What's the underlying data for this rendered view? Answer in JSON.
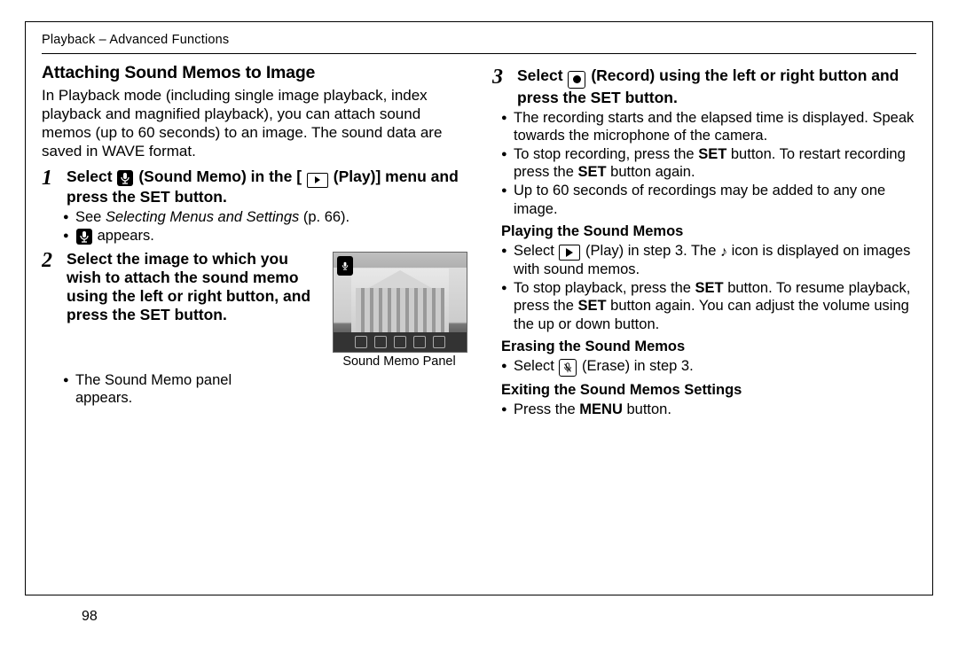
{
  "header": "Playback – Advanced Functions",
  "title": "Attaching Sound Memos to Image",
  "intro": "In Playback mode (including single image playback, index playback and magnified playback), you can attach sound memos (up to 60 seconds) to an image. The sound data are saved in WAVE format.",
  "step1_num": "1",
  "step1_a": "Select ",
  "step1_b": " (Sound Memo) in the [",
  "step1_c": " (Play)] menu and press the SET button.",
  "step1_bullets": {
    "b1a": "See ",
    "b1b": "Selecting Menus and Settings",
    "b1c": " (p. 66).",
    "b2": " appears."
  },
  "step2_num": "2",
  "step2": "Select the image to which you wish to attach the sound memo using the left or right button, and press the SET button.",
  "step2_bullet": "The Sound Memo panel appears.",
  "thumb_caption": "Sound Memo Panel",
  "step3_num": "3",
  "step3_a": "Select ",
  "step3_b": "(Record) using the left or right button and press the SET button.",
  "step3_bullets": {
    "b1": "The recording starts and the elapsed time is displayed. Speak towards the microphone of the camera.",
    "b2a": "To stop recording, press the ",
    "b2b": " button. To restart recording press the ",
    "b2c": " button again.",
    "b3": "Up to 60 seconds of recordings may be added to any one image."
  },
  "play_head": "Playing the Sound Memos",
  "play_bullets": {
    "b1a": "Select ",
    "b1b": " (Play) in step 3. The ",
    "b1c": " icon is displayed on images with sound memos.",
    "b2a": "To stop playback, press the ",
    "b2b": " button. To resume playback, press the ",
    "b2c": " button again. You can adjust the volume using the up or down button."
  },
  "erase_head": "Erasing the Sound Memos",
  "erase_a": "Select ",
  "erase_b": "(Erase) in step 3.",
  "exit_head": "Exiting the Sound Memos Settings",
  "exit_a": "Press the ",
  "exit_b": " button.",
  "set_label": "SET",
  "menu_label": "MENU",
  "page_number": "98"
}
